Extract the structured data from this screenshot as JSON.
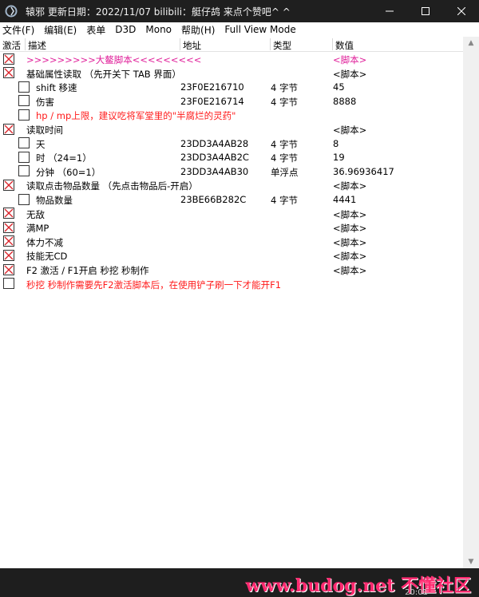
{
  "window": {
    "title": "辕邪    更新日期：2022/11/07    bilibili：艇仔鸪 来点个赞吧^ ^",
    "controls": [
      "minimize-icon",
      "maximize-icon",
      "close-icon"
    ]
  },
  "menu": [
    "文件(F)",
    "编辑(E)",
    "表单",
    "D3D",
    "Mono",
    "帮助(H)",
    "Full View Mode"
  ],
  "columns": [
    "激活",
    "描述",
    "地址",
    "类型",
    "数值"
  ],
  "rows": [
    {
      "checked": true,
      "indent": 0,
      "desc": ">>>>>>>>>大鳌脚本<<<<<<<<<",
      "address": "",
      "type": "",
      "value": "<脚本>",
      "color": "#e0209a"
    },
    {
      "checked": true,
      "indent": 0,
      "desc": "基础属性读取  （先开关下 TAB 界面）",
      "address": "",
      "type": "",
      "value": "<脚本>",
      "color": "#000000"
    },
    {
      "checked": false,
      "indent": 1,
      "desc": "shift 移速",
      "address": "23F0E216710",
      "type": "4 字节",
      "value": "45",
      "color": "#000000"
    },
    {
      "checked": false,
      "indent": 1,
      "desc": "伤害",
      "address": "23F0E216714",
      "type": "4 字节",
      "value": "8888",
      "color": "#000000"
    },
    {
      "checked": false,
      "indent": 1,
      "desc": "hp / mp上限，建议吃将军堂里的\"半腐烂的灵药\"",
      "address": "",
      "type": "",
      "value": "",
      "color": "#ff1a1a"
    },
    {
      "checked": true,
      "indent": 0,
      "desc": "读取时间",
      "address": "",
      "type": "",
      "value": "<脚本>",
      "color": "#000000"
    },
    {
      "checked": false,
      "indent": 1,
      "desc": "天",
      "address": "23DD3A4AB28",
      "type": "4 字节",
      "value": "8",
      "color": "#000000"
    },
    {
      "checked": false,
      "indent": 1,
      "desc": "时  （24=1）",
      "address": "23DD3A4AB2C",
      "type": "4 字节",
      "value": "19",
      "color": "#000000"
    },
    {
      "checked": false,
      "indent": 1,
      "desc": "分钟  （60=1）",
      "address": "23DD3A4AB30",
      "type": "单浮点",
      "value": "36.96936417",
      "color": "#000000"
    },
    {
      "checked": true,
      "indent": 0,
      "desc": "读取点击物品数量 （先点击物品后-开启）",
      "address": "",
      "type": "",
      "value": "<脚本>",
      "color": "#000000"
    },
    {
      "checked": false,
      "indent": 1,
      "desc": "物品数量",
      "address": "23BE66B282C",
      "type": "4 字节",
      "value": "4441",
      "color": "#000000"
    },
    {
      "checked": true,
      "indent": 0,
      "desc": "无敌",
      "address": "",
      "type": "",
      "value": "<脚本>",
      "color": "#000000"
    },
    {
      "checked": true,
      "indent": 0,
      "desc": "满MP",
      "address": "",
      "type": "",
      "value": "<脚本>",
      "color": "#000000"
    },
    {
      "checked": true,
      "indent": 0,
      "desc": "体力不减",
      "address": "",
      "type": "",
      "value": "<脚本>",
      "color": "#000000"
    },
    {
      "checked": true,
      "indent": 0,
      "desc": "技能无CD",
      "address": "",
      "type": "",
      "value": "<脚本>",
      "color": "#000000"
    },
    {
      "checked": true,
      "indent": 0,
      "desc": "  F2 激活 / F1开启 秒挖 秒制作",
      "address": "",
      "type": "",
      "value": "<脚本>",
      "color": "#000000"
    },
    {
      "checked": false,
      "indent": 0,
      "desc": "秒挖 秒制作需要先F2激活脚本后，在使用铲子刷一下才能开F1",
      "address": "",
      "type": "",
      "value": "",
      "color": "#ff1a1a"
    }
  ],
  "watermark": "www.budog.net 不懂社区",
  "taskbar_time": "20:01",
  "colors": {
    "titlebar": "#1f1f1f",
    "check_mark": "#d9232a",
    "script_highlight": "#e0209a",
    "note_red": "#ff1a1a"
  }
}
